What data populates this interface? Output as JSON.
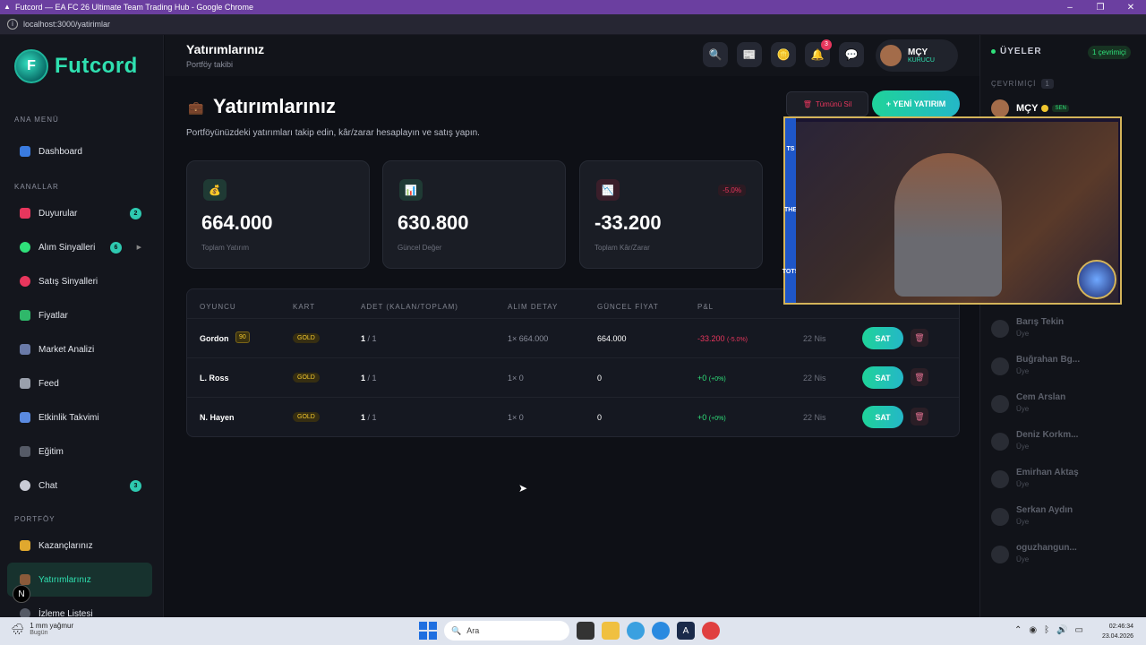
{
  "window": {
    "title": "Futcord — EA FC 26 Ultimate Team Trading Hub - Google Chrome",
    "url": "localhost:3000/yatirimlar"
  },
  "brand": {
    "name": "Futcord",
    "accent": "#2fe0b0"
  },
  "sidebar": {
    "sections": [
      {
        "title": "ANA MENÜ",
        "items": [
          {
            "label": "Dashboard",
            "icon": "chart-icon"
          }
        ]
      },
      {
        "title": "KANALLAR",
        "items": [
          {
            "label": "Duyurular",
            "icon": "megaphone-icon",
            "badge": "2"
          },
          {
            "label": "Alım Sinyalleri",
            "icon": "green-circle-icon",
            "badge": "6"
          },
          {
            "label": "Satış Sinyalleri",
            "icon": "red-circle-icon"
          },
          {
            "label": "Fiyatlar",
            "icon": "chart-up-icon"
          },
          {
            "label": "Market Analizi",
            "icon": "bar-chart-icon"
          },
          {
            "label": "Feed",
            "icon": "newspaper-icon"
          },
          {
            "label": "Etkinlik Takvimi",
            "icon": "calendar-icon"
          },
          {
            "label": "Eğitim",
            "icon": "graduation-icon"
          },
          {
            "label": "Chat",
            "icon": "chat-icon",
            "badge": "3"
          }
        ]
      },
      {
        "title": "PORTFÖY",
        "items": [
          {
            "label": "Kazançlarınız",
            "icon": "trophy-icon"
          },
          {
            "label": "Yatırımlarınız",
            "icon": "briefcase-icon",
            "active": true
          },
          {
            "label": "İzleme Listesi",
            "icon": "eye-icon"
          }
        ]
      }
    ]
  },
  "topbar": {
    "title": "Yatırımlarınız",
    "subtitle": "Portföy takibi",
    "notifications": "3",
    "user": {
      "name": "MÇY",
      "role": "KURUCU"
    }
  },
  "main": {
    "title": "Yatırımlarınız",
    "description": "Portföyünüzdeki yatırımları takip edin, kâr/zarar hesaplayın ve satış yapın.",
    "delete_all": "Tümünü Sil",
    "new_investment": "+ YENİ YATIRIM",
    "stats": [
      {
        "value": "664.000",
        "label": "Toplam Yatırım",
        "icon": "money-bag-icon"
      },
      {
        "value": "630.800",
        "label": "Güncel Değer",
        "icon": "chart-icon"
      },
      {
        "value": "-33.200",
        "label": "Toplam Kâr/Zarar",
        "icon": "chart-down-icon",
        "pct": "-5.0%"
      }
    ],
    "table": {
      "columns": [
        "OYUNCU",
        "KART",
        "ADET (KALAN/TOPLAM)",
        "ALIM DETAY",
        "GÜNCEL FİYAT",
        "P&L"
      ],
      "sell_label": "SAT",
      "rows": [
        {
          "player": "Gordon",
          "rating": "90",
          "card": "GOLD",
          "qty_left": "1",
          "qty_total": "/ 1",
          "buy_detail": "1× 664.000",
          "price": "664.000",
          "pnl": "-33.200",
          "pnl_pct": "(-5.0%)",
          "date": "22 Nis"
        },
        {
          "player": "L. Ross",
          "rating": "",
          "card": "GOLD",
          "qty_left": "1",
          "qty_total": "/ 1",
          "buy_detail": "1× 0",
          "price": "0",
          "pnl": "+0",
          "pnl_pct": "(+0%)",
          "date": "22 Nis"
        },
        {
          "player": "N. Hayen",
          "rating": "",
          "card": "GOLD",
          "qty_left": "1",
          "qty_total": "/ 1",
          "buy_detail": "1× 0",
          "price": "0",
          "pnl": "+0",
          "pnl_pct": "(+0%)",
          "date": "22 Nis"
        }
      ]
    }
  },
  "members": {
    "title": "ÜYELER",
    "online_badge": "1 çevrimiçi",
    "online_label": "ÇEVRİMİÇİ",
    "online_count": "1",
    "me": {
      "name": "MÇY",
      "tag": "SEN"
    },
    "list": [
      {
        "name": "Barış Tekin",
        "role": "Üye"
      },
      {
        "name": "Buğrahan Bg...",
        "role": "Üye"
      },
      {
        "name": "Cem Arslan",
        "role": "Üye"
      },
      {
        "name": "Deniz Korkm...",
        "role": "Üye"
      },
      {
        "name": "Emirhan Aktaş",
        "role": "Üye"
      },
      {
        "name": "Serkan Aydın",
        "role": "Üye"
      },
      {
        "name": "oguzhangun...",
        "role": "Üye"
      }
    ]
  },
  "webcam": {
    "band_text": [
      "TS",
      "THE",
      "TOTS"
    ]
  },
  "taskbar": {
    "weather": "1 mm yağmur",
    "weather_sub": "Bugün",
    "search_placeholder": "Ara",
    "time": "02:46:34",
    "date": "23.04.2026"
  }
}
